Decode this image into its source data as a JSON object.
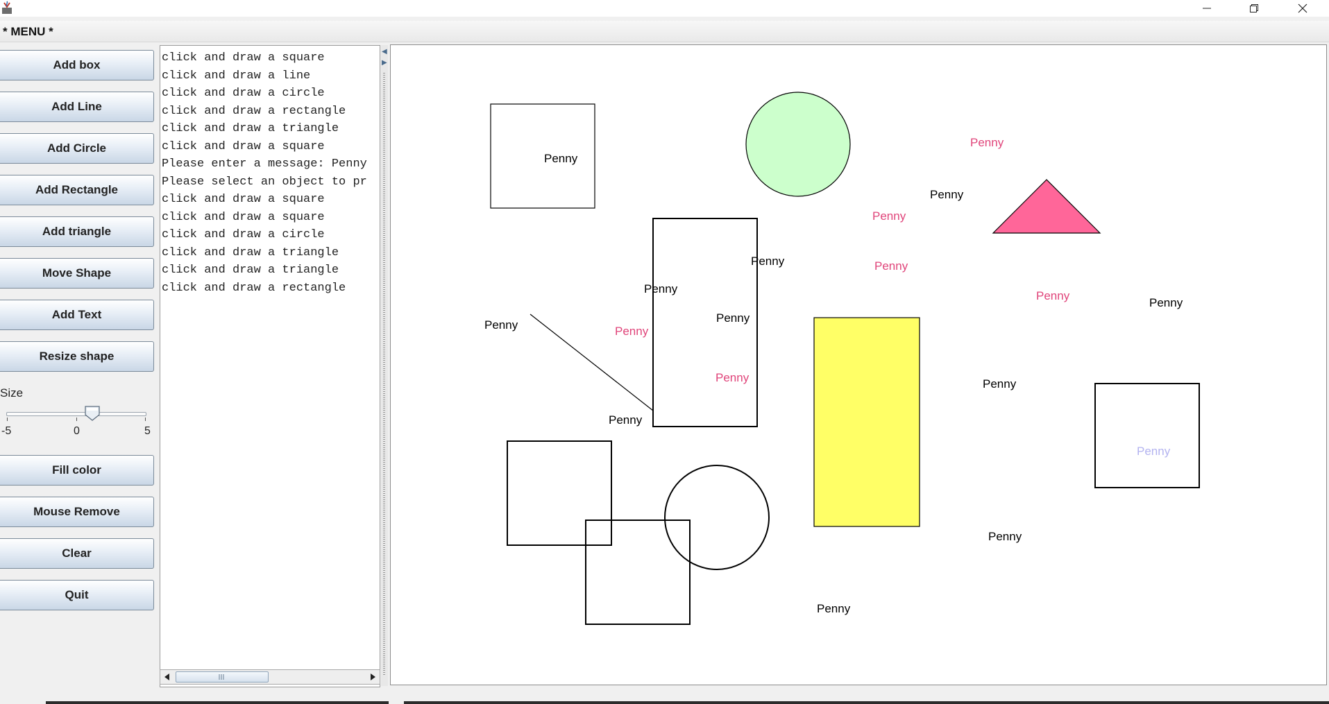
{
  "window": {
    "minimize_icon": "minimize-icon",
    "maximize_icon": "restore-icon",
    "close_icon": "close-icon"
  },
  "menu": {
    "label": "* MENU *"
  },
  "buttons": {
    "add_box": "Add box",
    "add_line": "Add Line",
    "add_circle": "Add Circle",
    "add_rectangle": "Add Rectangle",
    "add_triangle": "Add triangle",
    "move_shape": "Move Shape",
    "add_text": "Add Text",
    "resize_shape": "Resize shape",
    "fill_color": "Fill color",
    "mouse_remove": "Mouse Remove",
    "clear": "Clear",
    "quit": "Quit"
  },
  "size_slider": {
    "label": "Size",
    "min_label": "-5",
    "mid_label": "0",
    "max_label": "5",
    "min": -5,
    "max": 5,
    "value": 0.5
  },
  "log": {
    "lines": [
      "click and draw a square",
      "click and draw a line",
      "click and draw a circle",
      "click and draw a rectangle",
      "click and draw a triangle",
      "click and draw a square",
      "Please enter a message: Penny",
      "Please select an object to pr",
      "click and draw a square",
      "click and draw a square",
      "click and draw a circle",
      "click and draw a triangle",
      "click and draw a triangle",
      "click and draw a rectangle"
    ]
  },
  "canvas": {
    "colors": {
      "stroke": "#000000",
      "circle_fill": "#ccffcc",
      "triangle_fill": "#ff6699",
      "rect_fill": "#ffff66",
      "text_black": "#000000",
      "text_pink": "#e0447a",
      "text_lavender": "#b3b3f0"
    },
    "texts": {
      "t1": "Penny",
      "t2": "Penny",
      "t3": "Penny",
      "t4": "Penny",
      "t5": "Penny",
      "t6": "Penny",
      "t7": "Penny",
      "t8": "Penny",
      "t9": "Penny",
      "t10": "Penny",
      "t11": "Penny",
      "t12": "Penny",
      "t13": "Penny",
      "t14": "Penny",
      "t15": "Penny",
      "t16": "Penny",
      "t17": "Penny",
      "t18": "Penny"
    }
  }
}
